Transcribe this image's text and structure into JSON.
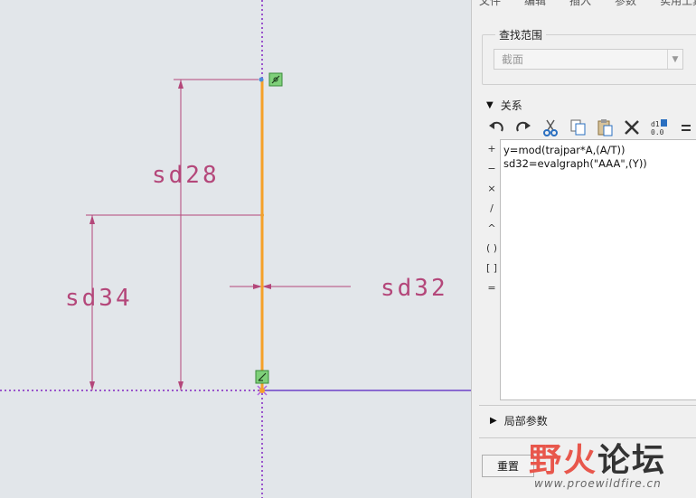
{
  "canvas": {
    "dimensions": [
      {
        "id": "sd28",
        "label": "sd28"
      },
      {
        "id": "sd34",
        "label": "sd34"
      },
      {
        "id": "sd32",
        "label": "sd32"
      }
    ],
    "colors": {
      "dimension": "#b4477a",
      "trajectory": "#f5a028",
      "centerline": "#9a55cc",
      "background": "#e2e6ea"
    }
  },
  "menu": {
    "items": [
      "文件",
      "编辑",
      "插入",
      "参数",
      "实用工具"
    ]
  },
  "search_scope": {
    "title": "查找范围",
    "value": "截面"
  },
  "relations": {
    "title": "关系",
    "toolbar": [
      "undo-icon",
      "redo-icon",
      "cut-icon",
      "copy-icon",
      "paste-icon",
      "delete-icon",
      "evaluate-icon",
      "equals-icon"
    ],
    "operators": [
      "+",
      "−",
      "×",
      "/",
      "^",
      "( )",
      "[ ]",
      "="
    ],
    "lines": [
      "y=mod(trajpar*A,(A/T))",
      "sd32=evalgraph(\"AAA\",(Y))"
    ]
  },
  "local_params": {
    "title": "局部参数"
  },
  "buttons": {
    "reset": "重置"
  },
  "watermark": {
    "part1": "野火",
    "part2": "论坛",
    "url": "www.proewildfire.cn"
  }
}
